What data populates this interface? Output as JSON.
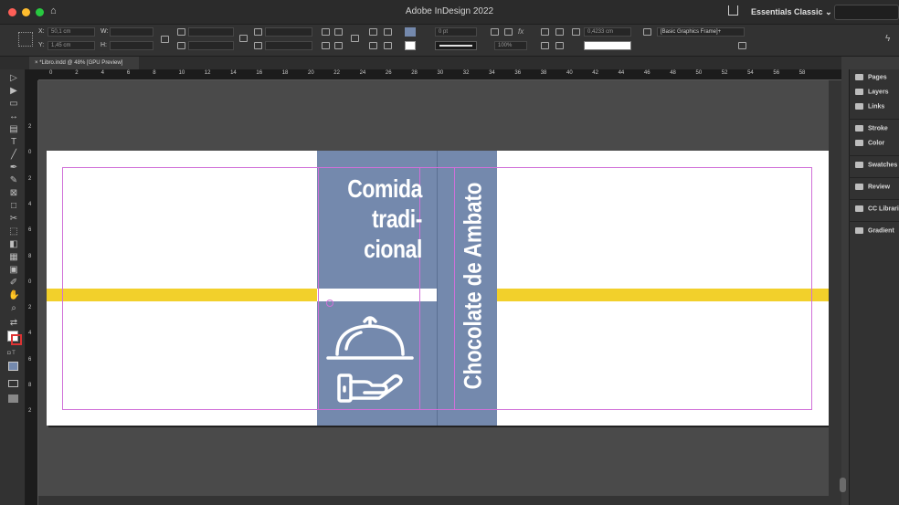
{
  "window": {
    "title": "Adobe InDesign 2022",
    "workspace": "Essentials Classic",
    "workspace_chevron": "⌄"
  },
  "control_bar": {
    "x_label": "X:",
    "x_value": "50,1 cm",
    "y_label": "Y:",
    "y_value": "1,45 cm",
    "w_label": "W:",
    "h_label": "H:",
    "stroke_weight": "0 pt",
    "zoom_percent": "100%",
    "gap_value": "0,4233 cm",
    "object_style": "[Basic Graphics Frame]+"
  },
  "document_tab": {
    "close": "×",
    "label": "*Libro.indd @ 48% [GPU Preview]"
  },
  "ruler": {
    "h_ticks": [
      "0",
      "2",
      "4",
      "6",
      "8",
      "10",
      "12",
      "14",
      "16",
      "18",
      "20",
      "22",
      "24",
      "26",
      "28",
      "30",
      "32",
      "34",
      "36",
      "38",
      "40",
      "42",
      "44",
      "46",
      "48",
      "50",
      "52",
      "54",
      "56",
      "58"
    ],
    "v_ticks": [
      "2",
      "0",
      "2",
      "4",
      "6",
      "8",
      "0",
      "2",
      "4",
      "6",
      "8",
      "2"
    ]
  },
  "artwork": {
    "heading_lines": [
      "Comida",
      "tradi-",
      "cional"
    ],
    "spine_title": "Chocolate de Ambato",
    "icon": "cloche-serving-hand-icon",
    "colors": {
      "panel_blue": "#7489ad",
      "stripe_yellow": "#f2d02b",
      "margin_guide": "#d070d8"
    }
  },
  "panels": [
    {
      "label": "Pages",
      "icon": "pages-icon"
    },
    {
      "label": "Layers",
      "icon": "layers-icon"
    },
    {
      "label": "Links",
      "icon": "links-icon"
    },
    {
      "label": "Stroke",
      "icon": "stroke-icon"
    },
    {
      "label": "Color",
      "icon": "color-icon"
    },
    {
      "label": "Swatches",
      "icon": "swatches-icon"
    },
    {
      "label": "Review",
      "icon": "review-icon"
    },
    {
      "label": "CC Librari",
      "icon": "cc-libraries-icon"
    },
    {
      "label": "Gradient",
      "icon": "gradient-icon"
    }
  ]
}
